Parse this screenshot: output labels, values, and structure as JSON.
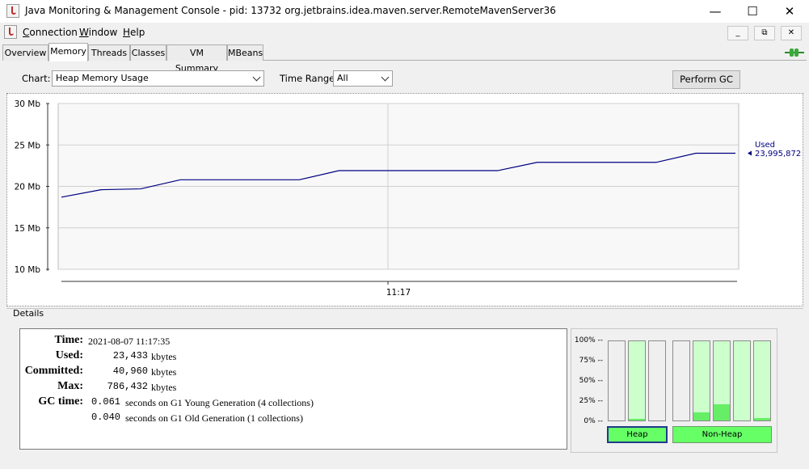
{
  "window": {
    "title": "Java Monitoring & Management Console - pid: 13732 org.jetbrains.idea.maven.server.RemoteMavenServer36",
    "minimize_glyph": "—",
    "maximize_glyph": "☐",
    "close_glyph": "✕"
  },
  "menu": {
    "items": [
      "Connection",
      "Window",
      "Help"
    ],
    "mdi_min": "_",
    "mdi_restore": "⧉",
    "mdi_close": "✕"
  },
  "tabs": [
    "Overview",
    "Memory",
    "Threads",
    "Classes",
    "VM Summary",
    "MBeans"
  ],
  "active_tab": "Memory",
  "toolbar": {
    "chart_label": "Chart:",
    "chart_value": "Heap Memory Usage",
    "range_label": "Time Range:",
    "range_value": "All",
    "gc_button": "Perform GC"
  },
  "chart_data": {
    "type": "line",
    "y_ticks": [
      "30 Mb",
      "25 Mb",
      "20 Mb",
      "15 Mb",
      "10 Mb"
    ],
    "x_ticks": [
      "11:17"
    ],
    "ylim": [
      10,
      30
    ],
    "series": [
      {
        "name": "Used",
        "color": "#000080",
        "points": [
          [
            0,
            18.7
          ],
          [
            1,
            19.6
          ],
          [
            2,
            19.7
          ],
          [
            3,
            20.8
          ],
          [
            6,
            20.8
          ],
          [
            7,
            21.9
          ],
          [
            11,
            21.9
          ],
          [
            12,
            22.9
          ],
          [
            15,
            22.9
          ],
          [
            16,
            24.0
          ],
          [
            17,
            24.0
          ]
        ]
      }
    ],
    "legend_value": "23,995,872"
  },
  "details": {
    "title": "Details",
    "rows": [
      {
        "key": "Time:",
        "value": "2021-08-07 11:17:35"
      },
      {
        "key": "Used:",
        "num": "23,433",
        "unit": "kbytes"
      },
      {
        "key": "Committed:",
        "num": "40,960",
        "unit": "kbytes"
      },
      {
        "key": "Max:",
        "num": "786,432",
        "unit": "kbytes"
      },
      {
        "key": "GC time:",
        "num": "0.061",
        "unit": "seconds on G1 Young Generation (4 collections)"
      },
      {
        "key": "",
        "num": "0.040",
        "unit": "seconds on G1 Old Generation (1 collections)"
      }
    ]
  },
  "pools": {
    "percent_ticks": [
      "100% --",
      "75% --",
      "50% --",
      "25% --",
      "0% --"
    ],
    "heap_label": "Heap",
    "nonheap_label": "Non-Heap",
    "heap_fill": [
      0.0,
      0.02,
      0.0
    ],
    "nonheap_fill": [
      0.0,
      0.1,
      0.2,
      0.0,
      0.03
    ]
  }
}
